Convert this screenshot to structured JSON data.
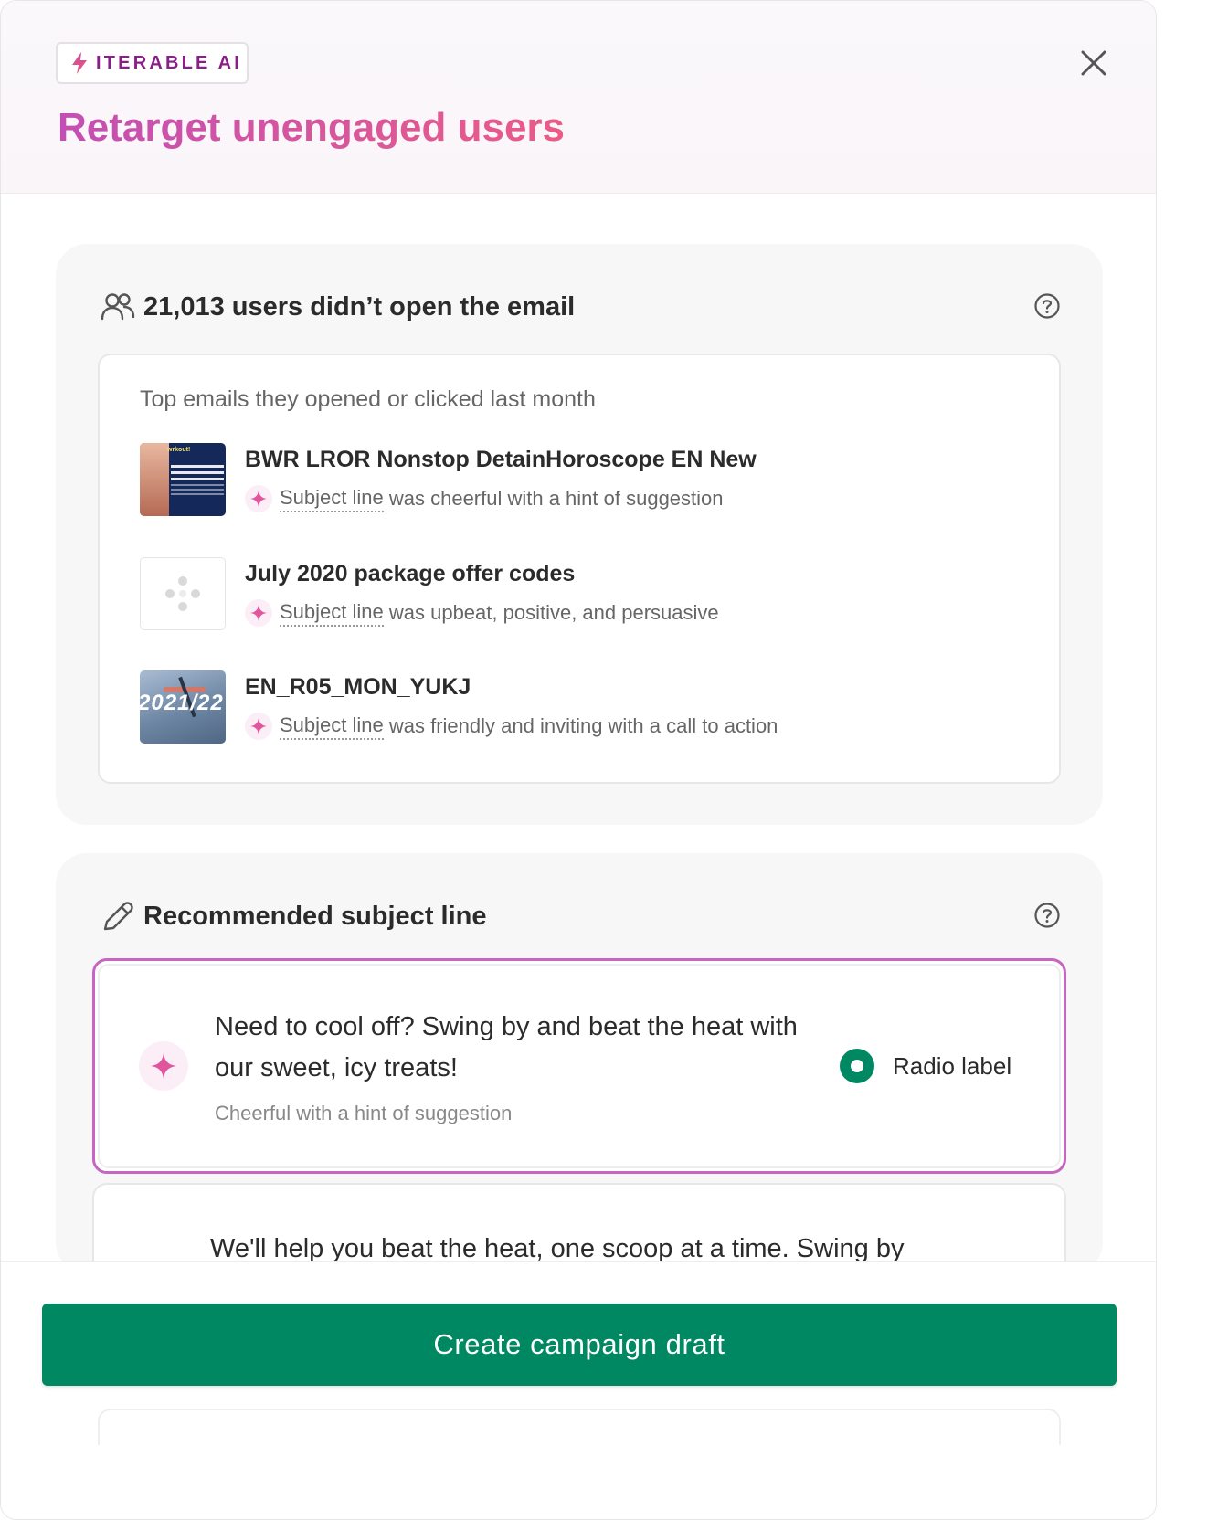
{
  "header": {
    "badge_text": "ITERABLE AI",
    "title": "Retarget unengaged users",
    "close_icon": "close-icon"
  },
  "audience": {
    "icon": "users-icon",
    "title": "21,013 users didn’t open the email",
    "subtitle": "Top emails they opened or clicked last month",
    "emails": [
      {
        "title": "BWR LROR Nonstop DetainHoroscope EN New",
        "link_text": "Subject line",
        "description": " was cheerful with a hint of suggestion",
        "thumb_logo": "wrkout!",
        "thumb_caption": "More workouts you enjoy, in the comfort of your home!"
      },
      {
        "title": "July 2020 package offer codes",
        "link_text": "Subject line",
        "description": " was upbeat, positive, and persuasive"
      },
      {
        "title": "EN_R05_MON_YUKJ",
        "link_text": "Subject line",
        "description": " was friendly and inviting with a call to action",
        "thumb_year": "2021/22"
      }
    ]
  },
  "recommendation": {
    "icon": "pencil-icon",
    "title": "Recommended subject line",
    "options": [
      {
        "text": "Need to cool off? Swing by and beat the heat with our sweet, icy treats!",
        "tone": "Cheerful with a hint of suggestion",
        "radio_label": "Radio label",
        "selected": true
      },
      {
        "text": "We'll help you beat the heat, one scoop at a time. Swing by"
      }
    ]
  },
  "footer": {
    "cta_label": "Create campaign draft"
  },
  "colors": {
    "accent_green": "#008862",
    "brand_purple": "#8a1f88",
    "title_gradient_start": "#c34fb4",
    "title_gradient_end": "#ea5c86",
    "sparkle_pink": "#e0559c",
    "selected_border": "#c665c2"
  }
}
